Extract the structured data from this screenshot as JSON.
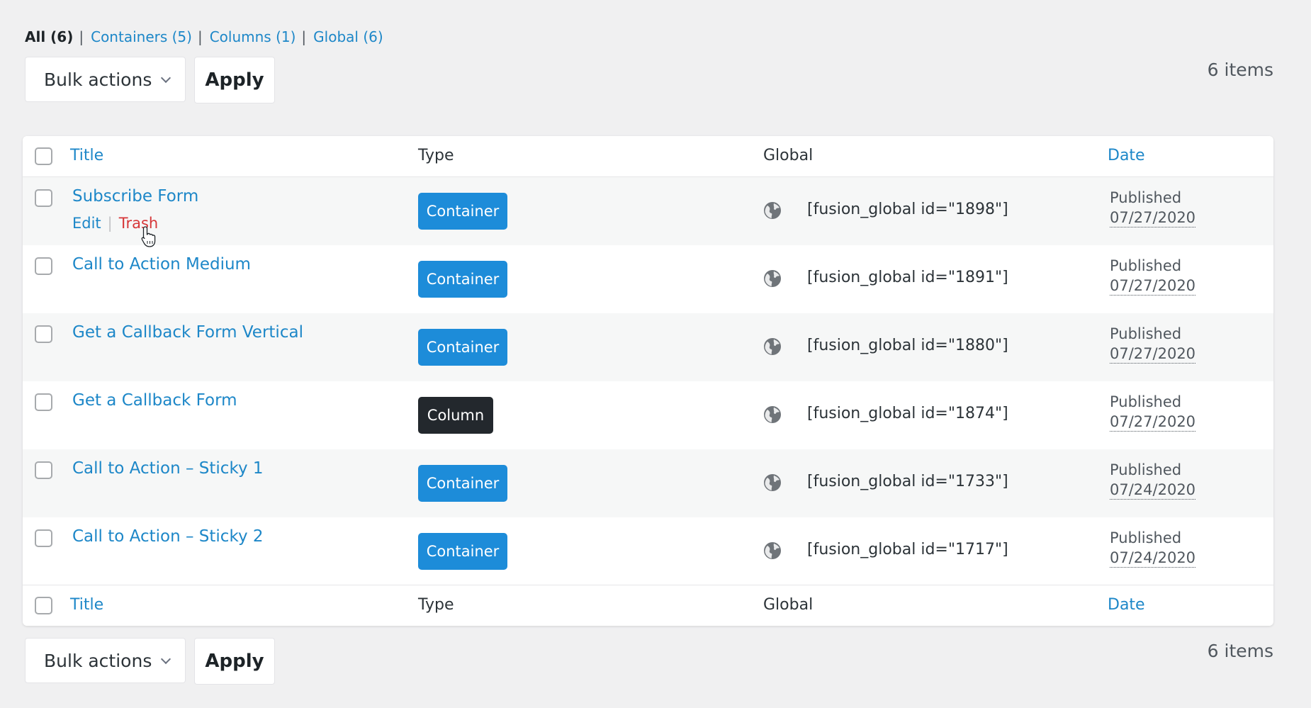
{
  "filters": {
    "all": "All (6)",
    "containers": "Containers (5)",
    "columns": "Columns (1)",
    "global": "Global (6)",
    "separator": "|"
  },
  "bulk": {
    "select_label": "Bulk actions",
    "apply_label": "Apply",
    "items_count": "6 items"
  },
  "columns": {
    "title": "Title",
    "type": "Type",
    "global": "Global",
    "date": "Date"
  },
  "row_actions": {
    "edit": "Edit",
    "trash": "Trash",
    "separator": "|"
  },
  "rows": [
    {
      "title": "Subscribe Form",
      "type": "Container",
      "shortcode": "[fusion_global id=\"1898\"]",
      "status": "Published",
      "date": "07/27/2020"
    },
    {
      "title": "Call to Action Medium",
      "type": "Container",
      "shortcode": "[fusion_global id=\"1891\"]",
      "status": "Published",
      "date": "07/27/2020"
    },
    {
      "title": "Get a Callback Form Vertical",
      "type": "Container",
      "shortcode": "[fusion_global id=\"1880\"]",
      "status": "Published",
      "date": "07/27/2020"
    },
    {
      "title": "Get a Callback Form",
      "type": "Column",
      "shortcode": "[fusion_global id=\"1874\"]",
      "status": "Published",
      "date": "07/27/2020"
    },
    {
      "title": "Call to Action – Sticky 1",
      "type": "Container",
      "shortcode": "[fusion_global id=\"1733\"]",
      "status": "Published",
      "date": "07/24/2020"
    },
    {
      "title": "Call to Action – Sticky 2",
      "type": "Container",
      "shortcode": "[fusion_global id=\"1717\"]",
      "status": "Published",
      "date": "07/24/2020"
    }
  ],
  "colors": {
    "link": "#1d87c8",
    "container_badge": "#1d8cd9",
    "column_badge": "#23282d",
    "trash": "#d63638",
    "background": "#f0f0f1"
  },
  "icons": {
    "global": "globe-icon",
    "select_arrow": "chevron-down-icon",
    "cursor": "hand-pointer-icon"
  }
}
